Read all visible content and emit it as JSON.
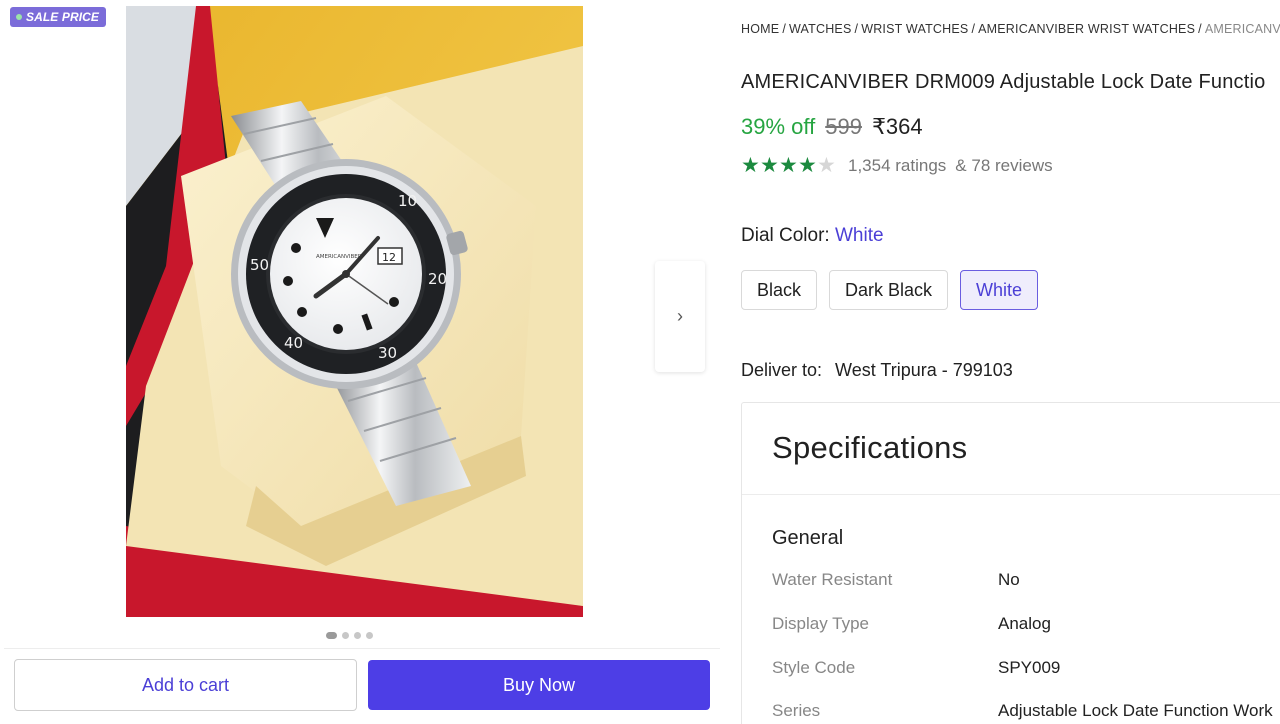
{
  "badge": {
    "label": "SALE PRICE"
  },
  "gallery": {
    "dial_brand_text": "AMERICANVIBER",
    "date_window": "12",
    "bezel_numbers": [
      "10",
      "20",
      "30",
      "40",
      "50"
    ],
    "dot_count": 4,
    "active_dot": 0,
    "next_icon": "chevron-right-icon"
  },
  "actions": {
    "add_to_cart": "Add to cart",
    "buy_now": "Buy Now"
  },
  "breadcrumb": [
    "HOME",
    "WATCHES",
    "WRIST WATCHES",
    "AMERICANVIBER WRIST WATCHES",
    "AMERICANV"
  ],
  "product": {
    "title": "AMERICANVIBER DRM009 Adjustable Lock Date Functio",
    "discount": "39% off",
    "mrp": "599",
    "price": "₹364",
    "rating_value": 4,
    "rating_max": 5,
    "ratings_count": "1,354 ratings",
    "reviews_count": "& 78 reviews"
  },
  "dial": {
    "label": "Dial Color:",
    "selected": "White",
    "options": [
      "Black",
      "Dark Black",
      "White"
    ]
  },
  "delivery": {
    "label": "Deliver to:",
    "location": "West Tripura - 799103"
  },
  "specifications": {
    "heading": "Specifications",
    "group": "General",
    "rows": [
      {
        "key": "Water Resistant",
        "value": "No"
      },
      {
        "key": "Display Type",
        "value": "Analog"
      },
      {
        "key": "Style Code",
        "value": "SPY009"
      },
      {
        "key": "Series",
        "value": "Adjustable Lock Date Function Work"
      }
    ]
  },
  "colors": {
    "accent": "#4d3ee6",
    "discount_green": "#26a541",
    "star_green": "#1c8a3f",
    "badge_purple": "#7b6cd9"
  }
}
